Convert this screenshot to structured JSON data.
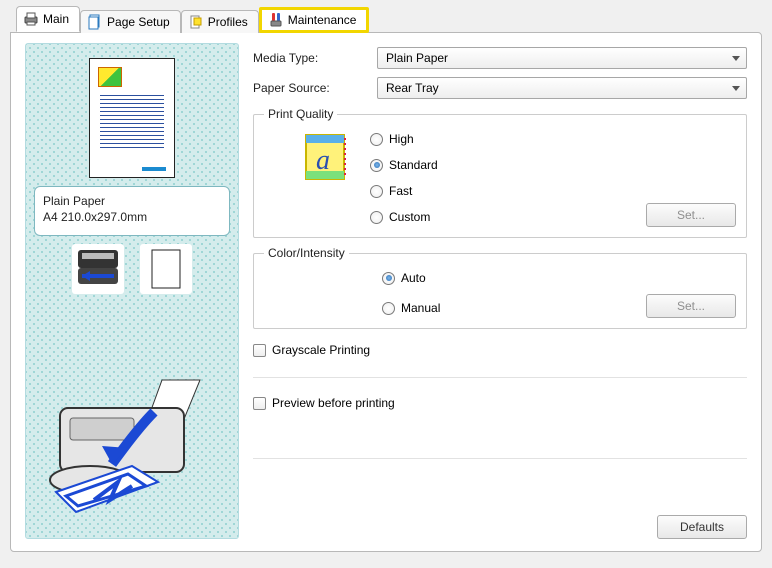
{
  "tabs": {
    "main": {
      "label": "Main"
    },
    "page_setup": {
      "label": "Page Setup"
    },
    "profiles": {
      "label": "Profiles"
    },
    "maintenance": {
      "label": "Maintenance"
    }
  },
  "left": {
    "paper_name": "Plain Paper",
    "paper_dim": "A4 210.0x297.0mm"
  },
  "form": {
    "media_type_label": "Media Type:",
    "media_type_value": "Plain Paper",
    "paper_source_label": "Paper Source:",
    "paper_source_value": "Rear Tray"
  },
  "print_quality": {
    "legend": "Print Quality",
    "options": {
      "high": "High",
      "standard": "Standard",
      "fast": "Fast",
      "custom": "Custom"
    },
    "selected": "standard",
    "set_btn": "Set..."
  },
  "color_intensity": {
    "legend": "Color/Intensity",
    "options": {
      "auto": "Auto",
      "manual": "Manual"
    },
    "selected": "auto",
    "set_btn": "Set..."
  },
  "checks": {
    "grayscale": "Grayscale Printing",
    "preview": "Preview before printing"
  },
  "buttons": {
    "defaults": "Defaults"
  }
}
